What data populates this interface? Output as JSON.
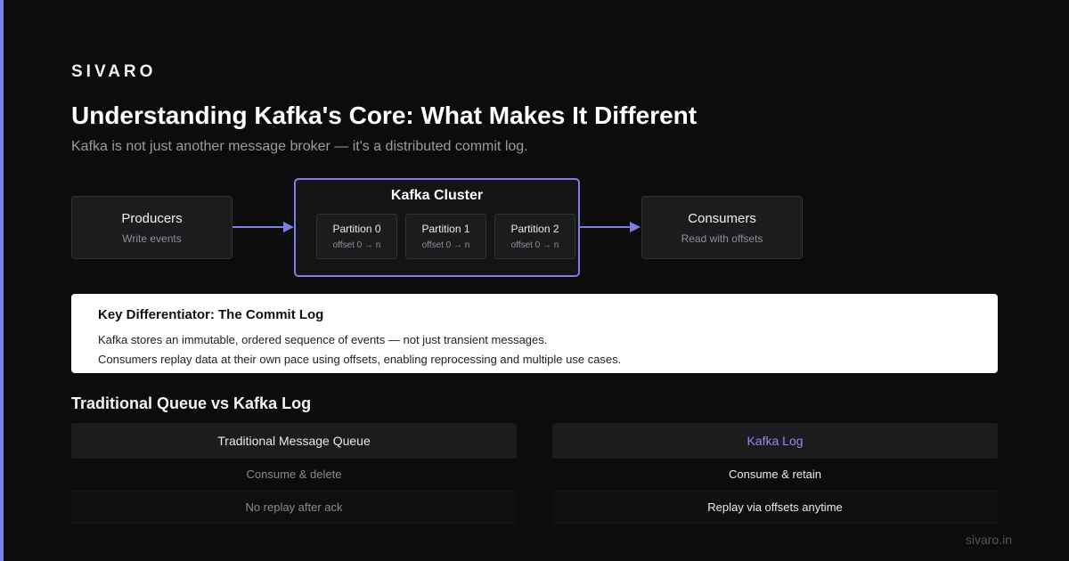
{
  "brand": "SIVARO",
  "title": "Understanding Kafka's Core: What Makes It Different",
  "subtitle": "Kafka is not just another message broker — it's a distributed commit log.",
  "colors": {
    "accent": "#7c7fe6",
    "background": "#0c0c0d",
    "card": "#1c1c1f"
  },
  "diagram": {
    "producers": {
      "name": "Producers",
      "desc": "Write events"
    },
    "cluster": {
      "title": "Kafka Cluster",
      "partitions": [
        {
          "name": "Partition 0",
          "offset": "offset 0 → n"
        },
        {
          "name": "Partition 1",
          "offset": "offset 0 → n"
        },
        {
          "name": "Partition 2",
          "offset": "offset 0 → n"
        }
      ]
    },
    "consumers": {
      "name": "Consumers",
      "desc": "Read with offsets"
    }
  },
  "callout": {
    "title": "Key Differentiator: The Commit Log",
    "lines": [
      "Kafka stores an immutable, ordered sequence of events — not just transient messages.",
      "Consumers replay data at their own pace using offsets, enabling reprocessing and multiple use cases."
    ]
  },
  "comparison": {
    "title": "Traditional Queue vs Kafka Log",
    "left": {
      "header": "Traditional Message Queue",
      "rows": [
        "Consume & delete",
        "No replay after ack"
      ]
    },
    "right": {
      "header": "Kafka Log",
      "rows": [
        "Consume & retain",
        "Replay via offsets anytime"
      ]
    }
  },
  "footer": "sivaro.in"
}
